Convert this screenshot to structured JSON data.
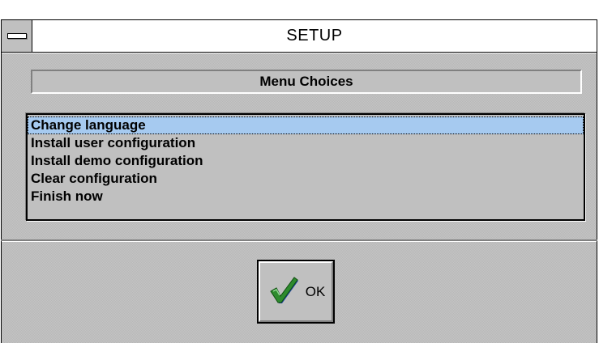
{
  "window": {
    "title": "SETUP"
  },
  "header": {
    "label": "Menu Choices"
  },
  "menu": {
    "items": [
      {
        "label": "Change language",
        "selected": true
      },
      {
        "label": "Install user configuration",
        "selected": false
      },
      {
        "label": "Install demo configuration",
        "selected": false
      },
      {
        "label": "Clear configuration",
        "selected": false
      },
      {
        "label": "Finish now",
        "selected": false
      }
    ]
  },
  "ok_button": {
    "label": "OK",
    "icon": "checkmark-icon"
  },
  "colors": {
    "face": "#c0c0c0",
    "selection": "#a6caf0",
    "check_green": "#2e8b2e"
  }
}
